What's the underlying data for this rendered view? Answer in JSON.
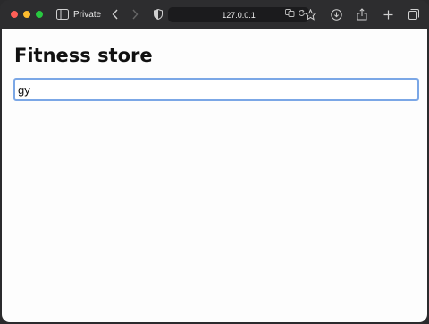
{
  "browser": {
    "private_label": "Private",
    "address": "127.0.0.1",
    "icons": {
      "sidebar": "sidebar-icon",
      "back": "chevron-left-icon",
      "forward": "chevron-right-icon",
      "privacy": "shield-icon",
      "translate": "translate-icon",
      "reload": "reload-icon",
      "bookmark": "star-icon",
      "downloads": "download-icon",
      "share": "share-icon",
      "new_tab": "plus-icon",
      "tabs": "tab-overview-icon"
    }
  },
  "page": {
    "title": "Fitness store",
    "search": {
      "value": "gy",
      "placeholder": ""
    }
  }
}
